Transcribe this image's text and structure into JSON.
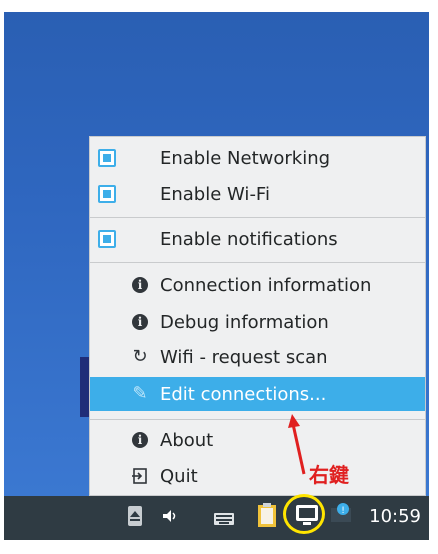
{
  "colors": {
    "menu_bg": "#eff0f1",
    "highlight": "#3daee9",
    "taskbar": "#2f3b43",
    "annotation_red": "#e02020",
    "annotation_yellow": "#ffe500"
  },
  "menu": {
    "toggles": [
      {
        "label": "Enable Networking",
        "checked": true
      },
      {
        "label": "Enable Wi-Fi",
        "checked": true
      },
      {
        "label": "Enable notifications",
        "checked": true
      }
    ],
    "actions": [
      {
        "label": "Connection information",
        "icon": "info-icon"
      },
      {
        "label": "Debug information",
        "icon": "info-icon"
      },
      {
        "label": "Wifi - request scan",
        "icon": "refresh-icon"
      },
      {
        "label": "Edit connections...",
        "icon": "pencil-icon",
        "highlighted": true
      }
    ],
    "bottom": [
      {
        "label": "About",
        "icon": "info-icon"
      },
      {
        "label": "Quit",
        "icon": "exit-icon"
      }
    ]
  },
  "taskbar": {
    "clock": "10:59",
    "tray_icons": [
      "eject-icon",
      "volume-icon",
      "keyboard-icon",
      "clipboard-icon",
      "network-icon",
      "notification-icon"
    ]
  },
  "annotation": {
    "text": "右鍵"
  }
}
